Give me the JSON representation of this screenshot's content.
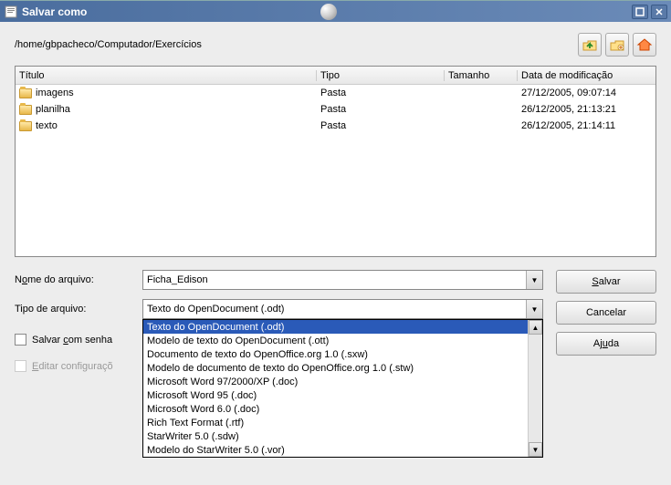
{
  "titlebar": {
    "title": "Salvar como"
  },
  "path": "/home/gbpacheco/Computador/Exercícios",
  "columns": {
    "titulo": "Título",
    "tipo": "Tipo",
    "tamanho": "Tamanho",
    "data": "Data de modificação"
  },
  "files": [
    {
      "name": "imagens",
      "type": "Pasta",
      "size": "",
      "date": "27/12/2005, 09:07:14"
    },
    {
      "name": "planilha",
      "type": "Pasta",
      "size": "",
      "date": "26/12/2005, 21:13:21"
    },
    {
      "name": "texto",
      "type": "Pasta",
      "size": "",
      "date": "26/12/2005, 21:14:11"
    }
  ],
  "form": {
    "filename_label_pre": "N",
    "filename_label_u": "o",
    "filename_label_post": "me do arquivo:",
    "filename_value": "Ficha_Edison",
    "filetype_label": "Tipo de arquivo:",
    "filetype_value": "Texto do OpenDocument (.odt)"
  },
  "dropdown": [
    "Texto do OpenDocument (.odt)",
    "Modelo de texto do OpenDocument (.ott)",
    "Documento de texto do OpenOffice.org 1.0 (.sxw)",
    "Modelo de documento de texto do OpenOffice.org 1.0 (.stw)",
    "Microsoft Word 97/2000/XP (.doc)",
    "Microsoft Word 95 (.doc)",
    "Microsoft Word 6.0 (.doc)",
    "Rich Text Format (.rtf)",
    "StarWriter 5.0 (.sdw)",
    "Modelo do StarWriter 5.0 (.vor)"
  ],
  "buttons": {
    "save_pre": "",
    "save_u": "S",
    "save_post": "alvar",
    "cancel": "Cancelar",
    "help_pre": "Aj",
    "help_u": "u",
    "help_post": "da"
  },
  "checks": {
    "password_pre": "Salvar ",
    "password_u": "c",
    "password_post": "om senha",
    "edit_pre": "",
    "edit_u": "E",
    "edit_post": "ditar configuraçõ"
  }
}
